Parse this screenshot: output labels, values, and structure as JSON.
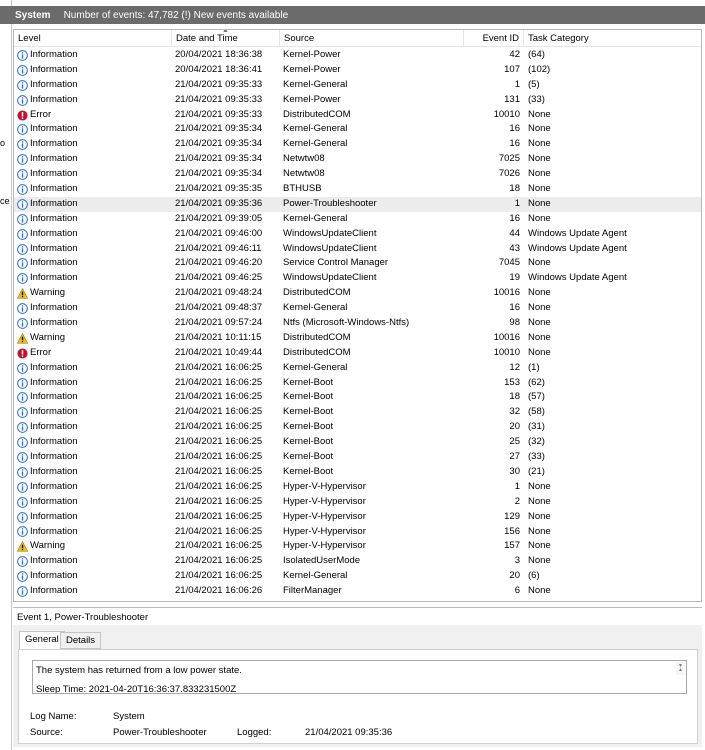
{
  "header": {
    "log_name": "System",
    "summary": "Number of events: 47,782 (!) New events available"
  },
  "left_strip": {
    "glyph_1": "o",
    "glyph_2": "ce"
  },
  "columns": {
    "level": "Level",
    "date": "Date and Time",
    "source": "Source",
    "event_id": "Event ID",
    "task_category": "Task Category"
  },
  "events": [
    {
      "level": "Information",
      "icon": "info-icon",
      "date": "20/04/2021 18:36:38",
      "source": "Kernel-Power",
      "id": "42",
      "category": "(64)"
    },
    {
      "level": "Information",
      "icon": "info-icon",
      "date": "20/04/2021 18:36:41",
      "source": "Kernel-Power",
      "id": "107",
      "category": "(102)"
    },
    {
      "level": "Information",
      "icon": "info-icon",
      "date": "21/04/2021 09:35:33",
      "source": "Kernel-General",
      "id": "1",
      "category": "(5)"
    },
    {
      "level": "Information",
      "icon": "info-icon",
      "date": "21/04/2021 09:35:33",
      "source": "Kernel-Power",
      "id": "131",
      "category": "(33)"
    },
    {
      "level": "Error",
      "icon": "error-icon",
      "date": "21/04/2021 09:35:33",
      "source": "DistributedCOM",
      "id": "10010",
      "category": "None"
    },
    {
      "level": "Information",
      "icon": "info-icon",
      "date": "21/04/2021 09:35:34",
      "source": "Kernel-General",
      "id": "16",
      "category": "None"
    },
    {
      "level": "Information",
      "icon": "info-icon",
      "date": "21/04/2021 09:35:34",
      "source": "Kernel-General",
      "id": "16",
      "category": "None"
    },
    {
      "level": "Information",
      "icon": "info-icon",
      "date": "21/04/2021 09:35:34",
      "source": "Netwtw08",
      "id": "7025",
      "category": "None"
    },
    {
      "level": "Information",
      "icon": "info-icon",
      "date": "21/04/2021 09:35:34",
      "source": "Netwtw08",
      "id": "7026",
      "category": "None"
    },
    {
      "level": "Information",
      "icon": "info-icon",
      "date": "21/04/2021 09:35:35",
      "source": "BTHUSB",
      "id": "18",
      "category": "None"
    },
    {
      "level": "Information",
      "icon": "info-icon",
      "date": "21/04/2021 09:35:36",
      "source": "Power-Troubleshooter",
      "id": "1",
      "category": "None",
      "selected": true
    },
    {
      "level": "Information",
      "icon": "info-icon",
      "date": "21/04/2021 09:39:05",
      "source": "Kernel-General",
      "id": "16",
      "category": "None"
    },
    {
      "level": "Information",
      "icon": "info-icon",
      "date": "21/04/2021 09:46:00",
      "source": "WindowsUpdateClient",
      "id": "44",
      "category": "Windows Update Agent"
    },
    {
      "level": "Information",
      "icon": "info-icon",
      "date": "21/04/2021 09:46:11",
      "source": "WindowsUpdateClient",
      "id": "43",
      "category": "Windows Update Agent"
    },
    {
      "level": "Information",
      "icon": "info-icon",
      "date": "21/04/2021 09:46:20",
      "source": "Service Control Manager",
      "id": "7045",
      "category": "None"
    },
    {
      "level": "Information",
      "icon": "info-icon",
      "date": "21/04/2021 09:46:25",
      "source": "WindowsUpdateClient",
      "id": "19",
      "category": "Windows Update Agent"
    },
    {
      "level": "Warning",
      "icon": "warning-icon",
      "date": "21/04/2021 09:48:24",
      "source": "DistributedCOM",
      "id": "10016",
      "category": "None"
    },
    {
      "level": "Information",
      "icon": "info-icon",
      "date": "21/04/2021 09:48:37",
      "source": "Kernel-General",
      "id": "16",
      "category": "None"
    },
    {
      "level": "Information",
      "icon": "info-icon",
      "date": "21/04/2021 09:57:24",
      "source": "Ntfs (Microsoft-Windows-Ntfs)",
      "id": "98",
      "category": "None"
    },
    {
      "level": "Warning",
      "icon": "warning-icon",
      "date": "21/04/2021 10:11:15",
      "source": "DistributedCOM",
      "id": "10016",
      "category": "None"
    },
    {
      "level": "Error",
      "icon": "error-icon",
      "date": "21/04/2021 10:49:44",
      "source": "DistributedCOM",
      "id": "10010",
      "category": "None"
    },
    {
      "level": "Information",
      "icon": "info-icon",
      "date": "21/04/2021 16:06:25",
      "source": "Kernel-General",
      "id": "12",
      "category": "(1)"
    },
    {
      "level": "Information",
      "icon": "info-icon",
      "date": "21/04/2021 16:06:25",
      "source": "Kernel-Boot",
      "id": "153",
      "category": "(62)"
    },
    {
      "level": "Information",
      "icon": "info-icon",
      "date": "21/04/2021 16:06:25",
      "source": "Kernel-Boot",
      "id": "18",
      "category": "(57)"
    },
    {
      "level": "Information",
      "icon": "info-icon",
      "date": "21/04/2021 16:06:25",
      "source": "Kernel-Boot",
      "id": "32",
      "category": "(58)"
    },
    {
      "level": "Information",
      "icon": "info-icon",
      "date": "21/04/2021 16:06:25",
      "source": "Kernel-Boot",
      "id": "20",
      "category": "(31)"
    },
    {
      "level": "Information",
      "icon": "info-icon",
      "date": "21/04/2021 16:06:25",
      "source": "Kernel-Boot",
      "id": "25",
      "category": "(32)"
    },
    {
      "level": "Information",
      "icon": "info-icon",
      "date": "21/04/2021 16:06:25",
      "source": "Kernel-Boot",
      "id": "27",
      "category": "(33)"
    },
    {
      "level": "Information",
      "icon": "info-icon",
      "date": "21/04/2021 16:06:25",
      "source": "Kernel-Boot",
      "id": "30",
      "category": "(21)"
    },
    {
      "level": "Information",
      "icon": "info-icon",
      "date": "21/04/2021 16:06:25",
      "source": "Hyper-V-Hypervisor",
      "id": "1",
      "category": "None"
    },
    {
      "level": "Information",
      "icon": "info-icon",
      "date": "21/04/2021 16:06:25",
      "source": "Hyper-V-Hypervisor",
      "id": "2",
      "category": "None"
    },
    {
      "level": "Information",
      "icon": "info-icon",
      "date": "21/04/2021 16:06:25",
      "source": "Hyper-V-Hypervisor",
      "id": "129",
      "category": "None"
    },
    {
      "level": "Information",
      "icon": "info-icon",
      "date": "21/04/2021 16:06:25",
      "source": "Hyper-V-Hypervisor",
      "id": "156",
      "category": "None"
    },
    {
      "level": "Warning",
      "icon": "warning-icon",
      "date": "21/04/2021 16:06:25",
      "source": "Hyper-V-Hypervisor",
      "id": "157",
      "category": "None"
    },
    {
      "level": "Information",
      "icon": "info-icon",
      "date": "21/04/2021 16:06:25",
      "source": "IsolatedUserMode",
      "id": "3",
      "category": "None"
    },
    {
      "level": "Information",
      "icon": "info-icon",
      "date": "21/04/2021 16:06:25",
      "source": "Kernel-General",
      "id": "20",
      "category": "(6)"
    },
    {
      "level": "Information",
      "icon": "info-icon",
      "date": "21/04/2021 16:06:26",
      "source": "FilterManager",
      "id": "6",
      "category": "None"
    }
  ],
  "detail": {
    "title": "Event 1, Power-Troubleshooter",
    "tabs": [
      "General",
      "Details"
    ],
    "message_line_1": "The system has returned from a low power state.",
    "message_line_2": "Sleep Time: 2021-04-20T16:36:37.833231500Z",
    "log_name_label": "Log Name:",
    "log_name_value": "System",
    "source_label": "Source:",
    "source_value": "Power-Troubleshooter",
    "logged_label": "Logged:",
    "logged_value": "21/04/2021 09:35:36"
  },
  "colors": {
    "titlebar": "#6b6b6b",
    "selected_row": "#ececec",
    "info": "#2a6fc9",
    "error": "#c8102e",
    "warning": "#f2c200"
  }
}
